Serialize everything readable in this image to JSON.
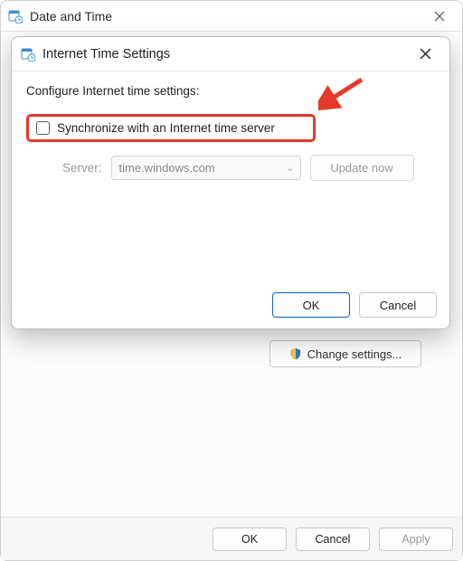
{
  "parent": {
    "title": "Date and Time",
    "change_settings_label": "Change settings...",
    "footer": {
      "ok": "OK",
      "cancel": "Cancel",
      "apply": "Apply"
    }
  },
  "modal": {
    "title": "Internet Time Settings",
    "config_label": "Configure Internet time settings:",
    "sync_label": "Synchronize with an Internet time server",
    "server_label": "Server:",
    "server_value": "time.windows.com",
    "update_label": "Update now",
    "footer": {
      "ok": "OK",
      "cancel": "Cancel"
    }
  }
}
